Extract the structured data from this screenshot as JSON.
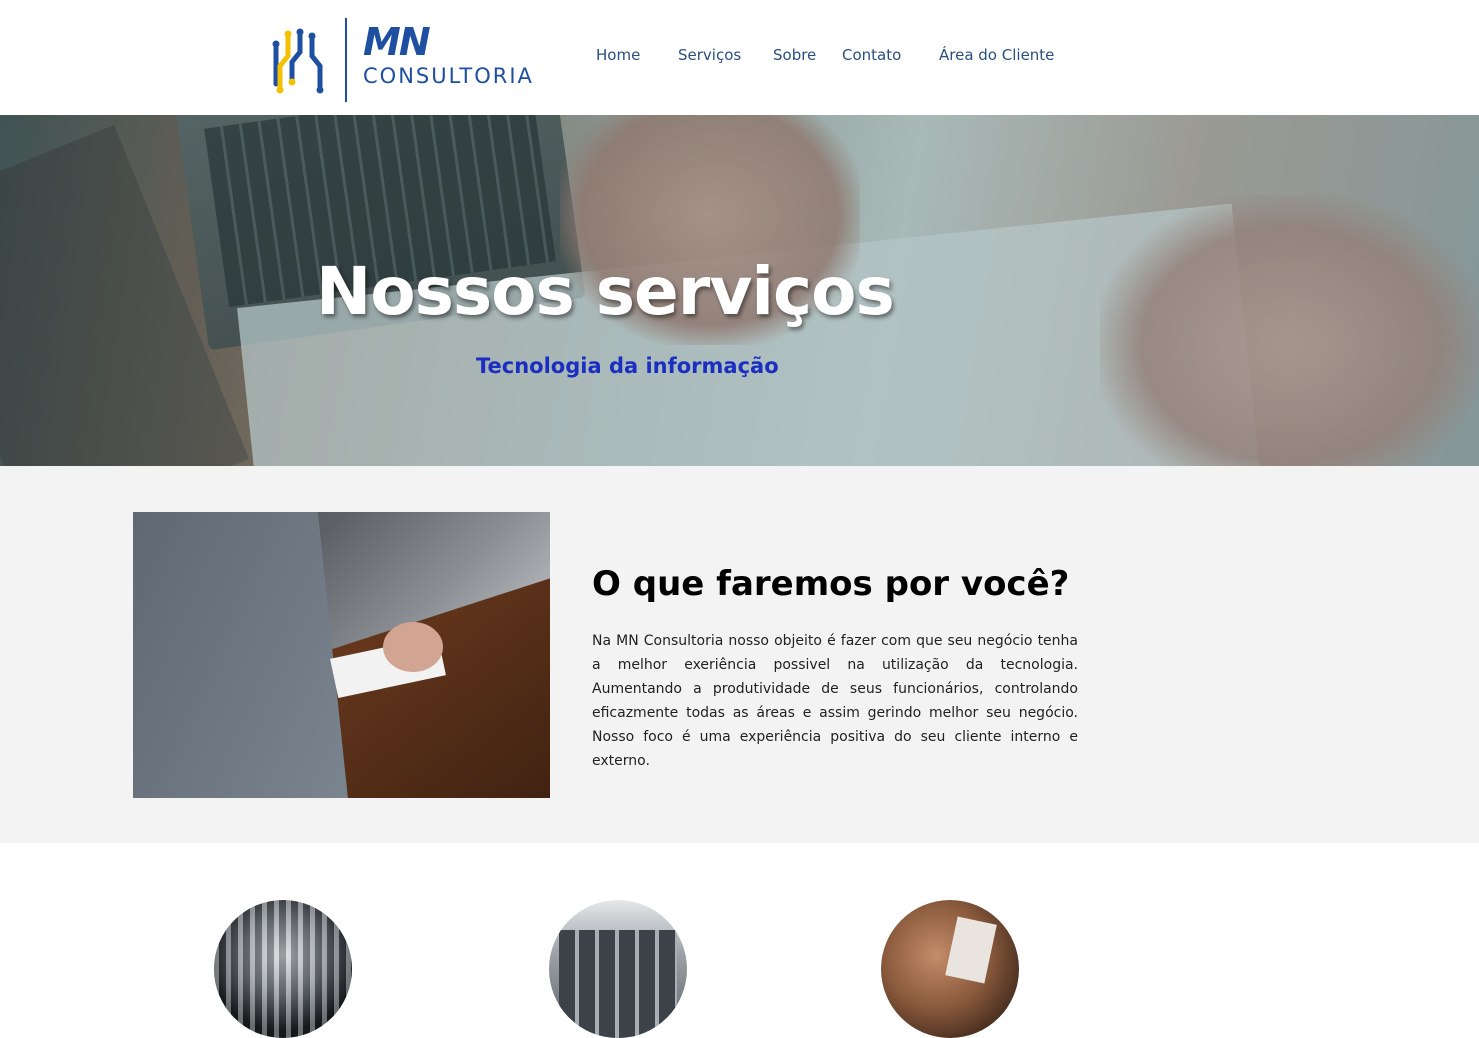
{
  "header": {
    "logo": {
      "mn_text": "MN",
      "sub_text": "CONSULTORIA"
    },
    "nav": [
      {
        "label": "Home"
      },
      {
        "label": "Serviços"
      },
      {
        "label": "Sobre"
      },
      {
        "label": "Contato"
      },
      {
        "label": "Área do Cliente"
      }
    ]
  },
  "hero": {
    "title": "Nossos serviços",
    "subtitle": "Tecnologia da informação"
  },
  "about": {
    "heading": "O que faremos por você?",
    "body": "Na MN Consultoria nosso objeito é fazer com que seu negócio tenha a melhor exeriência possivel na utilização da tecnologia. Aumentando a produtividade de seus funcionários, controlando eficazmente todas as áreas e assim gerindo melhor seu negócio. Nosso foco é uma experiência positiva do seu cliente interno e externo."
  },
  "colors": {
    "brand_blue": "#1f4fa0",
    "logo_yellow": "#f2c200",
    "nav_text": "#2b4f7e",
    "subtitle_blue": "#1a2fc2",
    "section_bg": "#f3f3f3"
  },
  "icons": {
    "logo_mark": "circuit-icon"
  }
}
